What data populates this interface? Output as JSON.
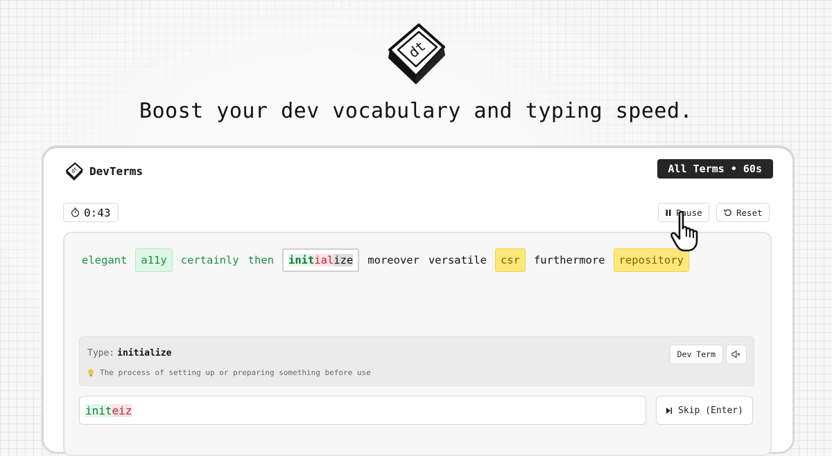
{
  "hero": {
    "logo_text": "dt",
    "headline": "Boost your dev vocabulary and typing speed."
  },
  "app": {
    "brand_name": "DevTerms",
    "brand_icon": "keycap-dt-icon",
    "mode_badge": "All Terms • 60s"
  },
  "toolbar": {
    "timer_icon": "stopwatch-icon",
    "timer_value": "0:43",
    "pause_label": "Pause",
    "pause_icon": "pause-icon",
    "reset_label": "Reset",
    "reset_icon": "rotate-ccw-icon"
  },
  "words": [
    {
      "text": "elegant",
      "state": "done"
    },
    {
      "text": "a11y",
      "state": "done-box"
    },
    {
      "text": "certainly",
      "state": "done"
    },
    {
      "text": "then",
      "state": "done"
    },
    {
      "text": "initialize",
      "state": "current",
      "parts": [
        "init",
        "ial",
        "ize"
      ]
    },
    {
      "text": "moreover",
      "state": "todo"
    },
    {
      "text": "versatile",
      "state": "todo"
    },
    {
      "text": "csr",
      "state": "dev-term"
    },
    {
      "text": "furthermore",
      "state": "todo"
    },
    {
      "text": "repository",
      "state": "dev-term"
    }
  ],
  "hint": {
    "type_label": "Type:",
    "type_word": "initialize",
    "definition_icon": "lightbulb-icon",
    "definition": "The process of setting up or preparing something before use",
    "dev_term_label": "Dev Term",
    "sound_icon": "speaker-muted-icon"
  },
  "input": {
    "correct": "init",
    "wrong": "eiz"
  },
  "skip": {
    "icon": "skip-forward-icon",
    "label": "Skip (Enter)"
  },
  "colors": {
    "correct": "#0f7a37",
    "wrong": "#c0242e",
    "dev_term_highlight": "#fde97a",
    "badge_bg": "#262626"
  }
}
